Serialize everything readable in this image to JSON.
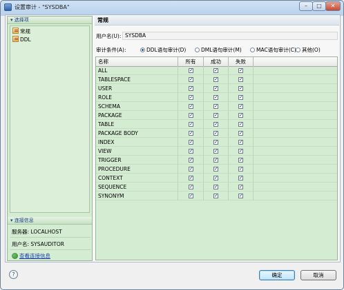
{
  "window": {
    "title": "设置审计 - \"SYSDBA\""
  },
  "left": {
    "options_header": "选择项",
    "tree": [
      "常规",
      "DDL"
    ],
    "conn_header": "连接信息",
    "server": "服务器: LOCALHOST",
    "user": "用户名: SYSAUDITOR",
    "view_link": "查看连接信息"
  },
  "main": {
    "header": "常规",
    "username_label": "用户名(U):",
    "username_value": "SYSDBA",
    "cond_label": "审计条件(A):",
    "radios": [
      {
        "label": "DDL语句审计(D)",
        "selected": true
      },
      {
        "label": "DML语句审计(M)",
        "selected": false
      },
      {
        "label": "MAC语句审计(C)",
        "selected": false
      },
      {
        "label": "其他(O)",
        "selected": false
      }
    ],
    "columns": [
      "名称",
      "所有",
      "成功",
      "失败"
    ],
    "rows": [
      "ALL",
      "TABLESPACE",
      "USER",
      "ROLE",
      "SCHEMA",
      "PACKAGE",
      "TABLE",
      "PACKAGE BODY",
      "INDEX",
      "VIEW",
      "TRIGGER",
      "PROCEDURE",
      "CONTEXT",
      "SEQUENCE",
      "SYNONYM"
    ],
    "check_mark": "✓"
  },
  "buttons": {
    "ok": "确定",
    "cancel": "取消",
    "help": "?"
  }
}
